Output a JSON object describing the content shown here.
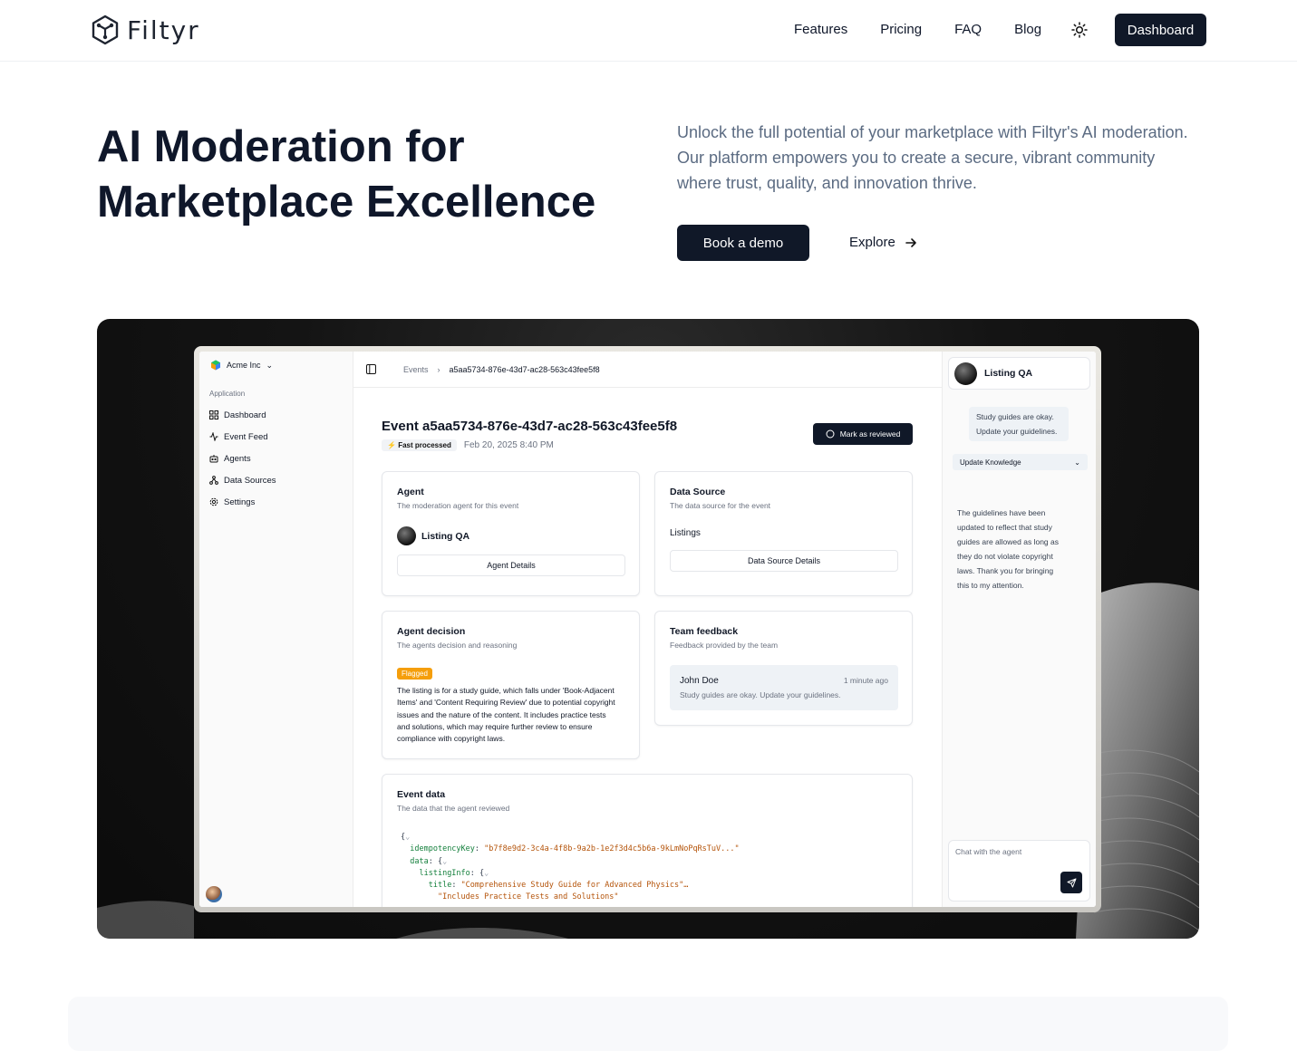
{
  "nav": {
    "brand": "Filtyr",
    "links": [
      "Features",
      "Pricing",
      "FAQ",
      "Blog"
    ],
    "theme_icon": "sun-icon",
    "dashboard_label": "Dashboard"
  },
  "hero": {
    "title_line1": "AI Moderation for",
    "title_line2": "Marketplace Excellence",
    "description": "Unlock the full potential of your marketplace with Filtyr's AI moderation. Our platform empowers you to create a secure, vibrant community where trust, quality, and innovation thrive.",
    "demo_label": "Book a demo",
    "explore_label": "Explore"
  },
  "app": {
    "org_name": "Acme Inc",
    "sidebar_section": "Application",
    "sidebar_items": [
      {
        "label": "Dashboard",
        "icon": "grid-icon"
      },
      {
        "label": "Event Feed",
        "icon": "activity-icon"
      },
      {
        "label": "Agents",
        "icon": "bot-icon"
      },
      {
        "label": "Data Sources",
        "icon": "network-icon"
      },
      {
        "label": "Settings",
        "icon": "gear-icon"
      }
    ],
    "breadcrumb": {
      "parent": "Events",
      "current": "a5aa5734-876e-43d7-ac28-563c43fee5f8"
    },
    "event_title": "Event a5aa5734-876e-43d7-ac28-563c43fee5f8",
    "fast_badge": "Fast processed",
    "timestamp": "Feb 20, 2025 8:40 PM",
    "mark_reviewed": "Mark as reviewed",
    "agent_card": {
      "title": "Agent",
      "subtitle": "The moderation agent for this event",
      "agent_name": "Listing QA",
      "button": "Agent Details"
    },
    "source_card": {
      "title": "Data Source",
      "subtitle": "The data source for the event",
      "source_name": "Listings",
      "button": "Data Source Details"
    },
    "decision_card": {
      "title": "Agent decision",
      "subtitle": "The agents decision and reasoning",
      "status": "Flagged",
      "reasoning": "The listing is for a study guide, which falls under 'Book-Adjacent Items' and 'Content Requiring Review' due to potential copyright issues and the nature of the content. It includes practice tests and solutions, which may require further review to ensure compliance with copyright laws."
    },
    "feedback_card": {
      "title": "Team feedback",
      "subtitle": "Feedback provided by the team",
      "author": "John Doe",
      "time": "1 minute ago",
      "text": "Study guides are okay. Update your guidelines."
    },
    "event_data_card": {
      "title": "Event data",
      "subtitle": "The data that the agent reviewed",
      "code": {
        "open": "{",
        "key1": "idempotencyKey",
        "val1": "\"b7f8e9d2-3c4a-4f8b-9a2b-1e2f3d4c5b6a-9kLmNoPqRsTuV...\"",
        "key2": "data",
        "key3": "listingInfo",
        "key4": "title",
        "val4": "\"Comprehensive Study Guide for Advanced Physics\"…",
        "val5": "\"Includes Practice Tests and Solutions\""
      }
    },
    "chat": {
      "agent_name": "Listing QA",
      "user_message": "Study guides are okay. Update your guidelines.",
      "tool_label": "Update Knowledge",
      "reply": "The guidelines have been updated to reflect that study guides are allowed as long as they do not violate copyright laws. Thank you for bringing this to my attention.",
      "input_placeholder": "Chat with the agent"
    }
  },
  "colors": {
    "primary": "#101828",
    "muted": "#5b6b82",
    "flag": "#f59e0b"
  }
}
